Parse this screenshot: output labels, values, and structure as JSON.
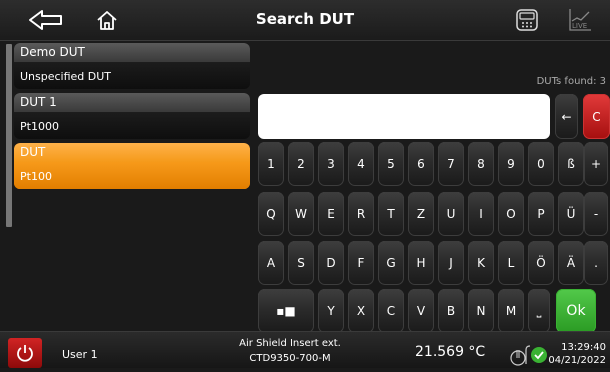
{
  "header": {
    "title": "Search DUT",
    "back_icon": "back-arrow-icon",
    "home_icon": "home-icon",
    "calc_icon": "calculator-icon",
    "live_label": "LIVE"
  },
  "duts": [
    {
      "name": "Demo DUT",
      "sensor": "Unspecified DUT",
      "selected": false
    },
    {
      "name": "DUT 1",
      "sensor": "Pt1000",
      "selected": false
    },
    {
      "name": "DUT",
      "sensor": "Pt100",
      "selected": true
    }
  ],
  "results": {
    "found_label": "DUTs found: 3"
  },
  "search": {
    "value": "",
    "backspace_label": "←",
    "clear_label": "C"
  },
  "keyboard": {
    "row1": [
      "1",
      "2",
      "3",
      "4",
      "5",
      "6",
      "7",
      "8",
      "9",
      "0",
      "ß",
      "+"
    ],
    "row2": [
      "Q",
      "W",
      "E",
      "R",
      "T",
      "Z",
      "U",
      "I",
      "O",
      "P",
      "Ü",
      "-"
    ],
    "row3": [
      "A",
      "S",
      "D",
      "F",
      "G",
      "H",
      "J",
      "K",
      "L",
      "Ö",
      "Ä",
      "."
    ],
    "row4": [
      "Y",
      "X",
      "C",
      "V",
      "B",
      "N",
      "M"
    ],
    "shift_label": "▪■",
    "space_label": "⎵",
    "ok_label": "Ok"
  },
  "footer": {
    "user": "User 1",
    "probe_line1": "Air Shield Insert ext.",
    "probe_line2": "CTD9350-700-M",
    "temperature": "21.569 °C",
    "time": "13:29:40",
    "date": "04/21/2022"
  },
  "colors": {
    "accent_orange": "#f59a1a",
    "clear_red": "#c81c1c",
    "ok_green": "#3ab233",
    "power_red": "#b31616"
  }
}
